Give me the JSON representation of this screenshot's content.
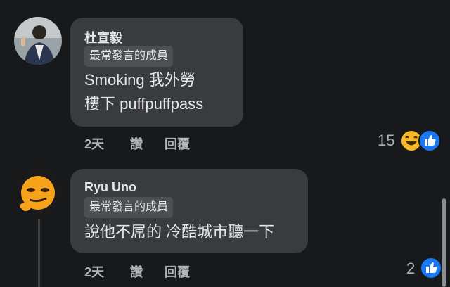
{
  "comments": [
    {
      "author": "杜宣毅",
      "badge": "最常發言的成員",
      "text_line1": "Smoking 我外勞",
      "text_line2": "樓下 puffpuffpass",
      "time": "2天",
      "like_action": "讚",
      "reply_action": "回覆",
      "reaction_count": "15",
      "reaction_icons": [
        "haha-icon",
        "like-icon"
      ]
    },
    {
      "author": "Ryu Uno",
      "badge": "最常發言的成員",
      "text_line1": "說他不屌的 冷酷城市聽一下",
      "time": "2天",
      "like_action": "讚",
      "reply_action": "回覆",
      "reaction_count": "2",
      "reaction_icons": [
        "like-icon"
      ]
    }
  ],
  "colors": {
    "background": "#18191a",
    "bubble": "#3a3b3c",
    "badge": "#4e4f50",
    "text": "#e4e6eb",
    "secondary_text": "#b0b3b8",
    "like_blue": "#1877f2",
    "haha_yellow": "#f7b928"
  }
}
